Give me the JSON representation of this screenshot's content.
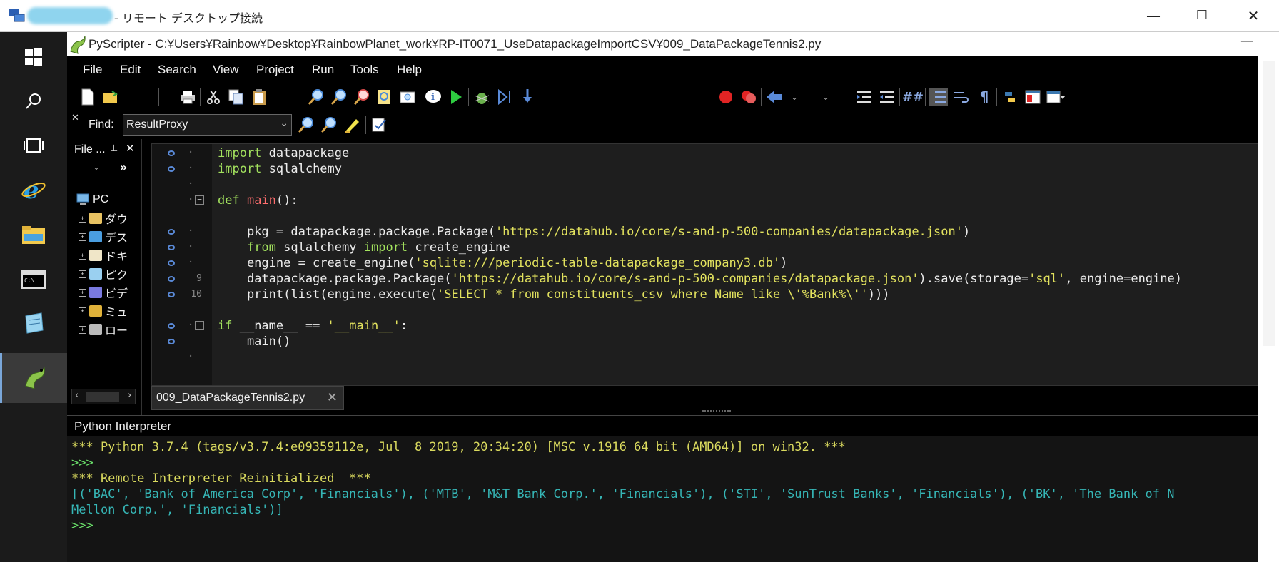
{
  "rdp": {
    "title": "- リモート デスクトップ接続",
    "minimize": "—",
    "maximize": "☐",
    "close": "✕"
  },
  "window": {
    "title": "PyScripter - C:¥Users¥Rainbow¥Desktop¥RainbowPlanet_work¥RP-IT0071_UseDatapackageImportCSV¥009_DataPackageTennis2.py",
    "minimize": "—"
  },
  "menu": [
    "File",
    "Edit",
    "Search",
    "View",
    "Project",
    "Run",
    "Tools",
    "Help"
  ],
  "find": {
    "label": "Find:",
    "value": "ResultProxy"
  },
  "file_pane": {
    "title": "File ...",
    "root": "PC",
    "items": [
      "ダウ",
      "デス",
      "ドキ",
      "ピク",
      "ビデ",
      "ミュ",
      "ロー"
    ]
  },
  "editor": {
    "tab_label": "009_DataPackageTennis2.py",
    "tab_close": "✕",
    "line_numbers": [
      "9",
      "10"
    ],
    "lines": [
      [
        {
          "t": "import ",
          "c": "kw"
        },
        {
          "t": "datapackage",
          "c": ""
        }
      ],
      [
        {
          "t": "import ",
          "c": "kw"
        },
        {
          "t": "sqlalchemy",
          "c": ""
        }
      ],
      [],
      [
        {
          "t": "def ",
          "c": "kw"
        },
        {
          "t": "main",
          "c": "fn"
        },
        {
          "t": "():",
          "c": ""
        }
      ],
      [],
      [
        {
          "t": "    pkg = datapackage.package.Package(",
          "c": ""
        },
        {
          "t": "'https://datahub.io/core/s-and-p-500-companies/datapackage.json'",
          "c": "str"
        },
        {
          "t": ")",
          "c": ""
        }
      ],
      [
        {
          "t": "    ",
          "c": ""
        },
        {
          "t": "from ",
          "c": "kw"
        },
        {
          "t": "sqlalchemy ",
          "c": ""
        },
        {
          "t": "import ",
          "c": "kw"
        },
        {
          "t": "create_engine",
          "c": ""
        }
      ],
      [
        {
          "t": "    engine = create_engine(",
          "c": ""
        },
        {
          "t": "'sqlite:///periodic-table-datapackage_company3.db'",
          "c": "str"
        },
        {
          "t": ")",
          "c": ""
        }
      ],
      [
        {
          "t": "    datapackage.package.Package(",
          "c": ""
        },
        {
          "t": "'https://datahub.io/core/s-and-p-500-companies/datapackage.json'",
          "c": "str"
        },
        {
          "t": ").save(storage=",
          "c": ""
        },
        {
          "t": "'sql'",
          "c": "str"
        },
        {
          "t": ", engine=engine)",
          "c": ""
        }
      ],
      [
        {
          "t": "    print(list(engine.execute(",
          "c": ""
        },
        {
          "t": "'SELECT * from constituents_csv where Name like \\'%Bank%\\''",
          "c": "str"
        },
        {
          "t": ")))",
          "c": ""
        }
      ],
      [],
      [
        {
          "t": "if ",
          "c": "kw"
        },
        {
          "t": "__name__ == ",
          "c": ""
        },
        {
          "t": "'__main__'",
          "c": "str"
        },
        {
          "t": ":",
          "c": ""
        }
      ],
      [
        {
          "t": "    main()",
          "c": ""
        }
      ],
      []
    ]
  },
  "interpreter": {
    "title": "Python Interpreter",
    "lines": [
      {
        "t": "*** Python 3.7.4 (tags/v3.7.4:e09359112e, Jul  8 2019, 20:34:20) [MSC v.1916 64 bit (AMD64)] on win32. ***",
        "c": "yellow"
      },
      {
        "t": ">>>",
        "c": "green"
      },
      {
        "t": "*** Remote Interpreter Reinitialized  ***",
        "c": "yellow"
      },
      {
        "t": "[('BAC', 'Bank of America Corp', 'Financials'), ('MTB', 'M&T Bank Corp.', 'Financials'), ('STI', 'SunTrust Banks', 'Financials'), ('BK', 'The Bank of N",
        "c": "cyan"
      },
      {
        "t": "Mellon Corp.', 'Financials')]",
        "c": "cyan"
      },
      {
        "t": ">>>",
        "c": "green"
      }
    ]
  },
  "colors": {
    "keyword": "#a3e25e",
    "function": "#ff6e6e",
    "string": "#e2e25e",
    "interp_output": "#36b6b6"
  }
}
